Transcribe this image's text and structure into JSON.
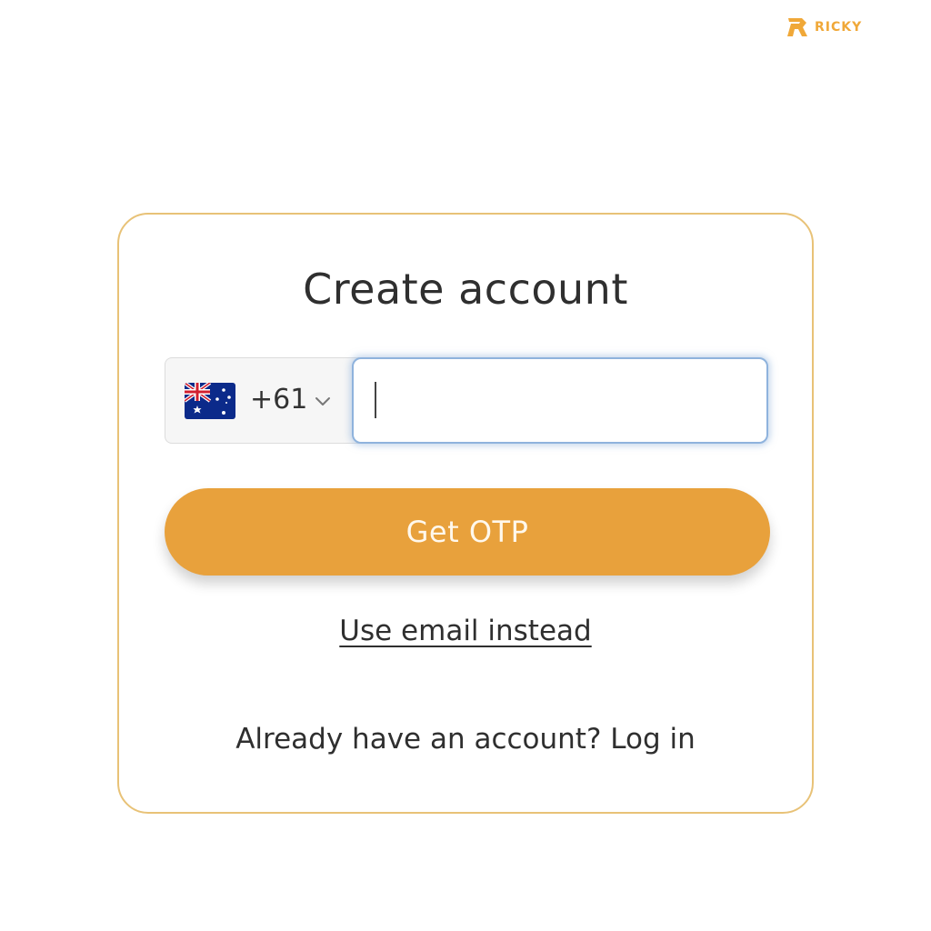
{
  "brand": {
    "name": "RICKY",
    "logo_icon": "ricky-logo-icon",
    "color": "#f0a838"
  },
  "form": {
    "title": "Create account",
    "country": {
      "flag_icon": "australia-flag-icon",
      "dial_code": "+61",
      "dropdown_icon": "chevron-down-icon"
    },
    "phone_input": {
      "value": "",
      "placeholder": ""
    },
    "submit_label": "Get OTP",
    "alt_method_label": "Use email instead",
    "login_prompt": "Already have an account?",
    "login_link": "Log in"
  },
  "colors": {
    "accent": "#e8a13c",
    "card_border": "#e8c277",
    "input_focus": "#8fb3dd",
    "text": "#2f2f2f"
  }
}
